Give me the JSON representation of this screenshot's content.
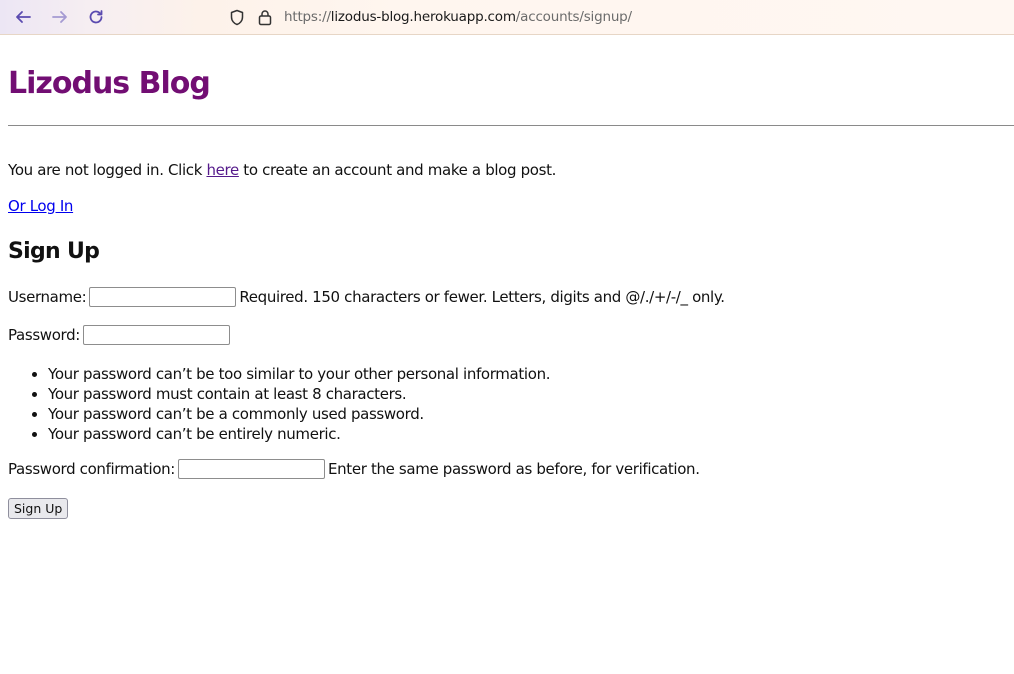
{
  "browser": {
    "url_scheme": "https://",
    "url_host": "lizodus-blog.herokuapp.com",
    "url_path": "/accounts/signup/"
  },
  "page": {
    "site_title": "Lizodus Blog",
    "notice_before": "You are not logged in. Click ",
    "notice_link": "here",
    "notice_after": " to create an account and make a blog post.",
    "login_link": "Or Log In",
    "heading": "Sign Up"
  },
  "form": {
    "username_label": "Username:",
    "username_value": "",
    "username_help": "Required. 150 characters or fewer. Letters, digits and @/./+/-/_ only.",
    "password_label": "Password:",
    "password_value": "",
    "password_rules": [
      "Your password can’t be too similar to your other personal information.",
      "Your password must contain at least 8 characters.",
      "Your password can’t be a commonly used password.",
      "Your password can’t be entirely numeric."
    ],
    "confirm_label": "Password confirmation:",
    "confirm_value": "",
    "confirm_help": "Enter the same password as before, for verification.",
    "submit_label": "Sign Up"
  },
  "colors": {
    "site_title": "#720e73",
    "visited_link": "#551a8b",
    "link": "#0000ee"
  }
}
